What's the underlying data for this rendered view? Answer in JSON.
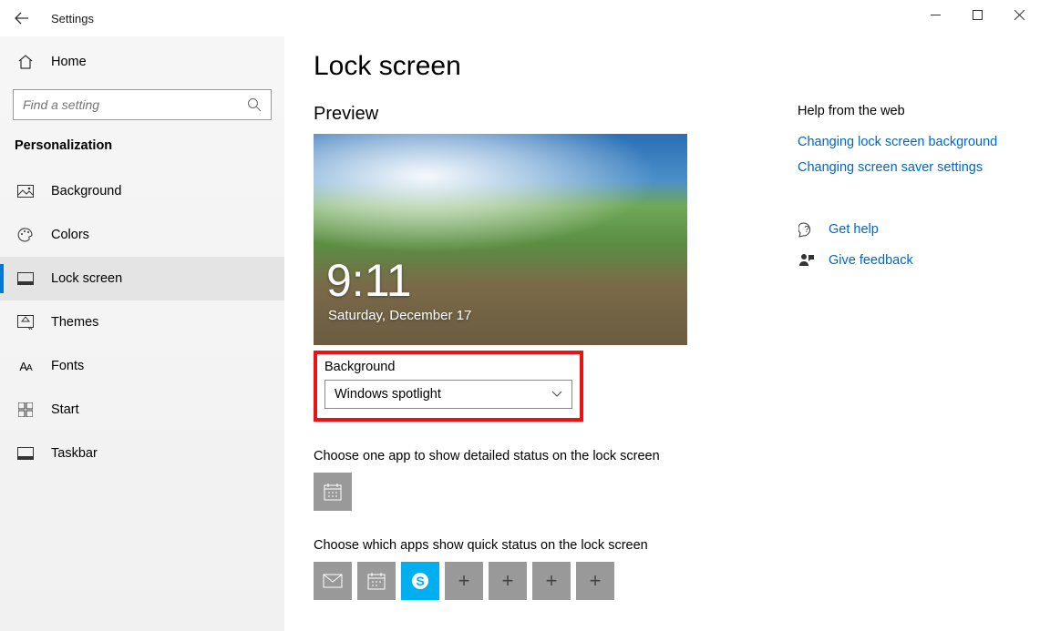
{
  "window": {
    "title": "Settings"
  },
  "sidebar": {
    "home": "Home",
    "search_placeholder": "Find a setting",
    "heading": "Personalization",
    "items": [
      {
        "label": "Background"
      },
      {
        "label": "Colors"
      },
      {
        "label": "Lock screen"
      },
      {
        "label": "Themes"
      },
      {
        "label": "Fonts"
      },
      {
        "label": "Start"
      },
      {
        "label": "Taskbar"
      }
    ]
  },
  "main": {
    "title": "Lock screen",
    "preview_label": "Preview",
    "preview_time": "9:11",
    "preview_date": "Saturday, December 17",
    "background_label": "Background",
    "background_value": "Windows spotlight",
    "detailed_label": "Choose one app to show detailed status on the lock screen",
    "quick_label": "Choose which apps show quick status on the lock screen"
  },
  "right": {
    "help_header": "Help from the web",
    "link1": "Changing lock screen background",
    "link2": "Changing screen saver settings",
    "get_help": "Get help",
    "feedback": "Give feedback"
  }
}
